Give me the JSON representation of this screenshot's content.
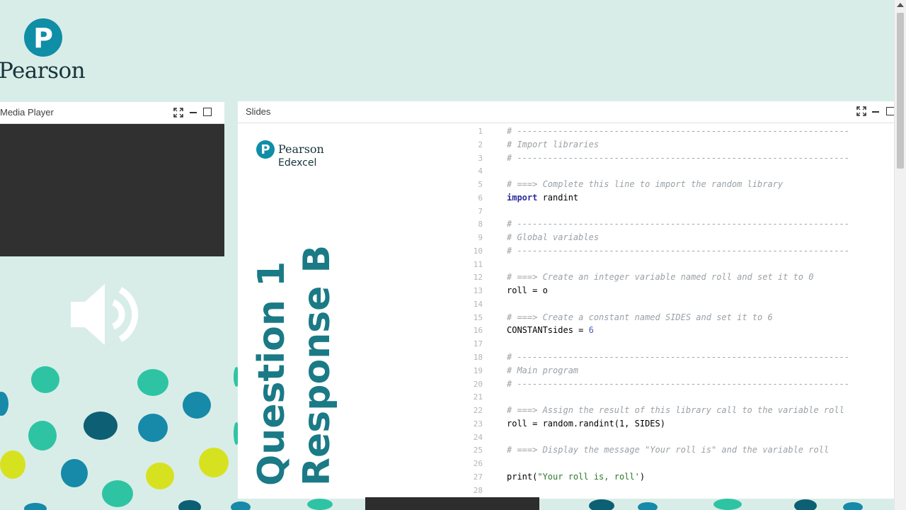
{
  "brand": {
    "logo_letter": "P",
    "logo_word": "Pearson"
  },
  "media_player": {
    "title": "Media Player",
    "icon": "speaker-icon"
  },
  "slides": {
    "title": "Slides",
    "logo_letter": "P",
    "brand_word": "Pearson",
    "brand_sub": "Edexcel",
    "question_label": "Question 1",
    "response_label": "Response B"
  },
  "code_lines": [
    {
      "n": "1",
      "text": "# -----------------------------------------------------------------",
      "kind": "comment"
    },
    {
      "n": "2",
      "text": "# Import libraries",
      "kind": "comment"
    },
    {
      "n": "3",
      "text": "# -----------------------------------------------------------------",
      "kind": "comment"
    },
    {
      "n": "4",
      "text": "",
      "kind": "plain"
    },
    {
      "n": "5",
      "text": "# ===> Complete this line to import the random library",
      "kind": "comment"
    },
    {
      "n": "6",
      "kw": "import",
      "text": " randint",
      "kind": "kw"
    },
    {
      "n": "7",
      "text": "",
      "kind": "plain"
    },
    {
      "n": "8",
      "text": "# -----------------------------------------------------------------",
      "kind": "comment"
    },
    {
      "n": "9",
      "text": "# Global variables",
      "kind": "comment"
    },
    {
      "n": "10",
      "text": "# -----------------------------------------------------------------",
      "kind": "comment"
    },
    {
      "n": "11",
      "text": "",
      "kind": "plain"
    },
    {
      "n": "12",
      "text": "# ===> Create an integer variable named roll and set it to 0",
      "kind": "comment"
    },
    {
      "n": "13",
      "text": "roll = o",
      "kind": "plain"
    },
    {
      "n": "14",
      "text": "",
      "kind": "plain"
    },
    {
      "n": "15",
      "text": "# ===> Create a constant named SIDES and set it to 6",
      "kind": "comment"
    },
    {
      "n": "16",
      "text": "CONSTANTsides = ",
      "num": "6",
      "kind": "num"
    },
    {
      "n": "17",
      "text": "",
      "kind": "plain"
    },
    {
      "n": "18",
      "text": "# -----------------------------------------------------------------",
      "kind": "comment"
    },
    {
      "n": "19",
      "text": "# Main program",
      "kind": "comment"
    },
    {
      "n": "20",
      "text": "# -----------------------------------------------------------------",
      "kind": "comment"
    },
    {
      "n": "21",
      "text": "",
      "kind": "plain"
    },
    {
      "n": "22",
      "text": "# ===> Assign the result of this library call to the variable roll",
      "kind": "comment"
    },
    {
      "n": "23",
      "text": "roll = random.randint(1, SIDES)",
      "kind": "plain"
    },
    {
      "n": "24",
      "text": "",
      "kind": "plain"
    },
    {
      "n": "25",
      "text": "# ===> Display the message \"Your roll is\" and the variable roll",
      "kind": "comment"
    },
    {
      "n": "26",
      "text": "",
      "kind": "plain"
    },
    {
      "n": "27",
      "pre": "print(",
      "str": "\"Your roll is, roll'",
      "post": ")",
      "kind": "str"
    },
    {
      "n": "28",
      "text": "",
      "kind": "plain"
    }
  ],
  "colors": {
    "background": "#d9ede8",
    "brand_teal": "#0f8ea6",
    "dot_lime": "#d6e21f",
    "dot_mint": "#2ec4a3",
    "dot_blue": "#168aa8",
    "dot_navy": "#0d5f73"
  }
}
